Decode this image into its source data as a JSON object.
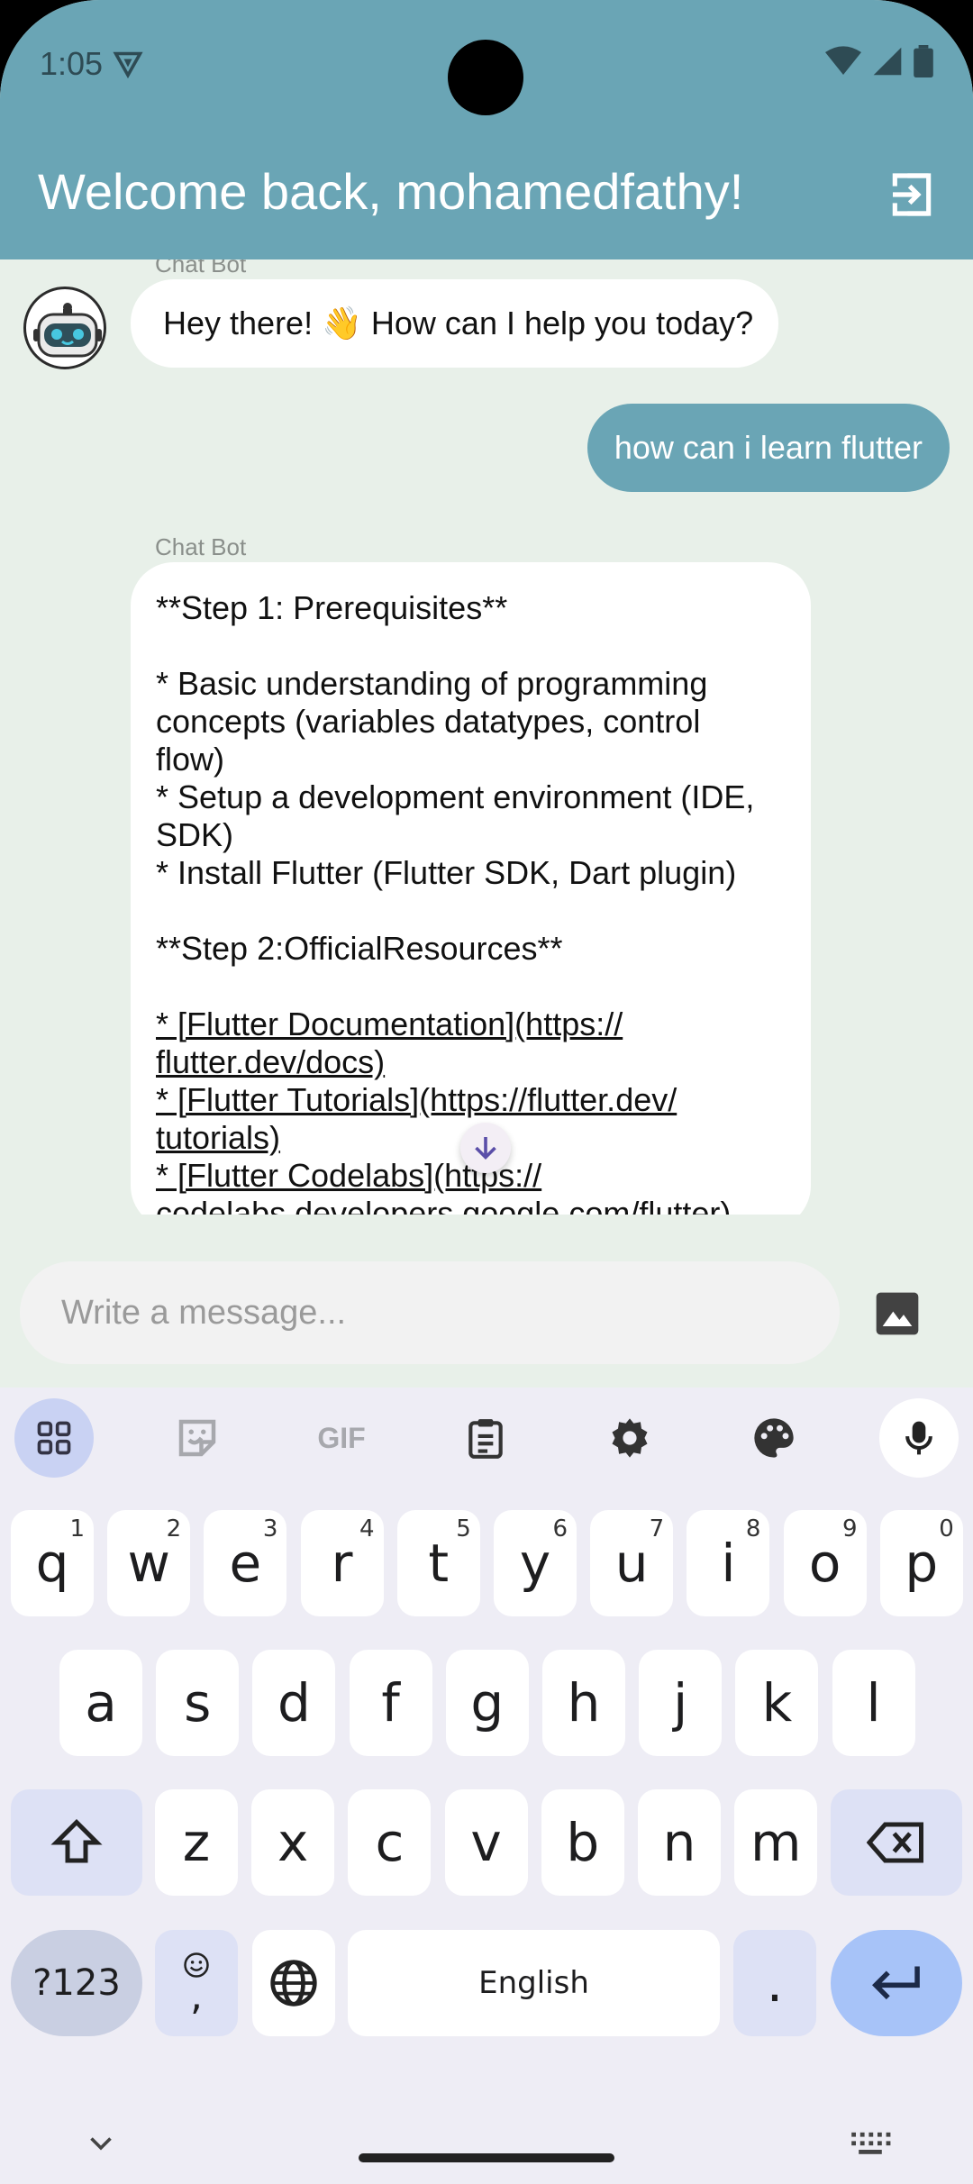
{
  "status_bar": {
    "time": "1:05"
  },
  "header": {
    "title": "Welcome back, mohamedfathy!"
  },
  "chat": {
    "sender_name": "Chat Bot",
    "bot_greeting": "Hey there! 👋 How can I help you today?",
    "user_message": "how can i learn flutter",
    "bot_reply_lines": [
      " **Step 1: Prerequisites**",
      "",
      "* Basic understanding of programming",
      "concepts (variables datatypes, control",
      "flow)",
      "* Setup a development environment (IDE,",
      "SDK)",
      "* Install Flutter (Flutter SDK, Dart plugin)",
      "",
      "**Step 2:OfficialResources**",
      "",
      "* [Flutter Documentation](https://",
      "flutter.dev/docs)",
      "* [Flutter Tutorials](https://flutter.dev/",
      "tutorials)",
      "* [Flutter Codelabs](https://",
      "codelabs.developers.google.com/flutter)"
    ]
  },
  "composer": {
    "placeholder": "Write a message..."
  },
  "keyboard": {
    "row1": [
      {
        "k": "q",
        "n": "1"
      },
      {
        "k": "w",
        "n": "2"
      },
      {
        "k": "e",
        "n": "3"
      },
      {
        "k": "r",
        "n": "4"
      },
      {
        "k": "t",
        "n": "5"
      },
      {
        "k": "y",
        "n": "6"
      },
      {
        "k": "u",
        "n": "7"
      },
      {
        "k": "i",
        "n": "8"
      },
      {
        "k": "o",
        "n": "9"
      },
      {
        "k": "p",
        "n": "0"
      }
    ],
    "row2": [
      "a",
      "s",
      "d",
      "f",
      "g",
      "h",
      "j",
      "k",
      "l"
    ],
    "row3": [
      "z",
      "x",
      "c",
      "v",
      "b",
      "n",
      "m"
    ],
    "symbols_label": "?123",
    "emoji_comma": ",",
    "space_label": "English",
    "period": ".",
    "gif_label": "GIF"
  },
  "colors": {
    "app_bar": "#6aa5b5",
    "chat_bg": "#e8f0e9",
    "user_bubble": "#6aa5b5",
    "keyboard_bg": "#eeedf5"
  }
}
